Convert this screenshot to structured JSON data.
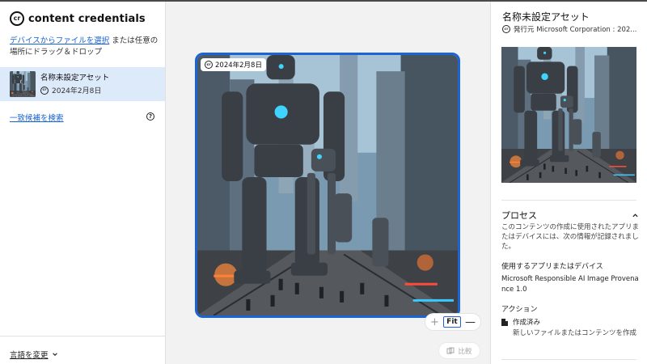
{
  "brand": {
    "name": "content credentials",
    "mark": "cr"
  },
  "upload": {
    "link": "デバイスからファイルを選択",
    "rest": " または任意の場所にドラッグ＆ドロップ"
  },
  "asset": {
    "name": "名称未設定アセット",
    "date": "2024年2月8日"
  },
  "search_link": "一致候補を検索",
  "help_symbol": "?",
  "language_link": "言語を変更",
  "canvas": {
    "date_badge": "2024年2月8日"
  },
  "zoom": {
    "plus": "+",
    "fit": "Fit",
    "minus": "—"
  },
  "compare_label": "比較",
  "details": {
    "title": "名称未設定アセット",
    "issuer": "発行元 Microsoft Corporation : 202...",
    "section_title": "プロセス",
    "section_desc": "このコンテンツの作成に使用されたアプリまたはデバイスには、次の情報が記録されました。",
    "app_label": "使用するアプリまたはデバイス",
    "app_value": "Microsoft Responsible AI Image Provenance 1.0",
    "actions_label": "アクション",
    "action_title": "作成済み",
    "action_desc": "新しいファイルまたはコンテンツを作成"
  },
  "colors": {
    "accent": "#1c63d6",
    "link": "#1662d4",
    "selected_bg": "#ddeafa",
    "canvas_bg": "#f2f2f2"
  },
  "icons": [
    "cr-logo-icon",
    "help-icon",
    "chevron-down-icon",
    "chevron-up-icon",
    "compare-icon",
    "document-icon"
  ]
}
